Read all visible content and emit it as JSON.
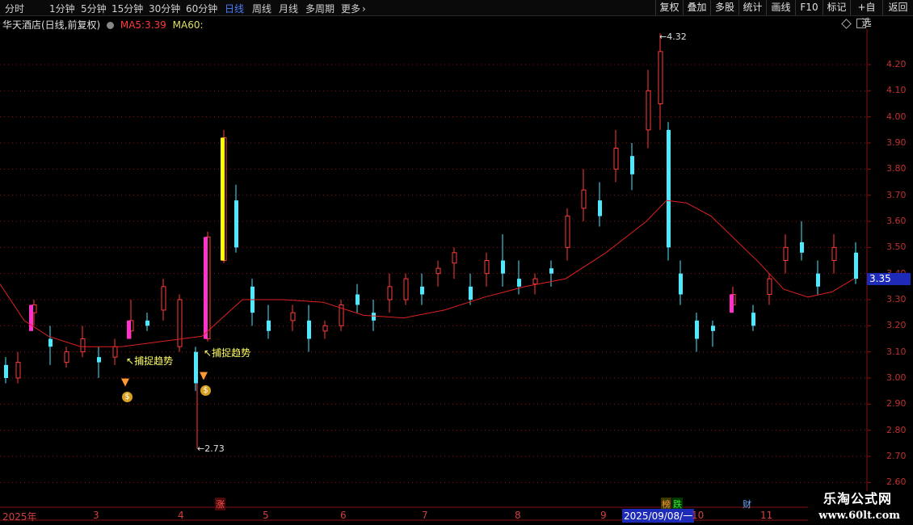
{
  "toolbar": {
    "timeframes": [
      "分时",
      "1分钟",
      "5分钟",
      "15分钟",
      "30分钟",
      "60分钟",
      "日线",
      "周线",
      "月线",
      "多周期",
      "更多"
    ],
    "active": "日线",
    "more_icon": "chevron-right-icon",
    "right_buttons": [
      "复权",
      "叠加",
      "多股",
      "统计",
      "画线",
      "F10",
      "标记",
      "+自选",
      "返回"
    ]
  },
  "legend": {
    "title": "华天酒店(日线,前复权)",
    "ma5_label": "MA5:",
    "ma5_value": "3.39",
    "ma60_label": "MA60:"
  },
  "annotations": {
    "high": "4.32",
    "low": "2.73",
    "signal1": "捕捉趋势",
    "signal2": "捕捉趋势",
    "arrow": "↖"
  },
  "markers": {
    "zhang": "涨",
    "bang": "榜",
    "die": "跌",
    "cai": "财"
  },
  "current_price": "3.35",
  "axis_ticks": [
    "4.20",
    "4.10",
    "4.00",
    "3.90",
    "3.80",
    "3.70",
    "3.60",
    "3.50",
    "3.40",
    "3.30",
    "3.20",
    "3.10",
    "3.00",
    "2.90",
    "2.80",
    "2.70",
    "2.60"
  ],
  "months": [
    "2025年",
    "3",
    "4",
    "5",
    "6",
    "7",
    "8",
    "9",
    "10",
    "11"
  ],
  "date_highlight": "2025/09/08/一",
  "watermark": {
    "line1": "乐淘公式网",
    "line2": "www.60lt.com"
  },
  "colors": {
    "up": "#ff3a3a",
    "down": "#4ee8ff",
    "ma60": "#e02020",
    "grid": "#8a1010",
    "signal_text": "#ffff66",
    "highlight_bar_yellow": "#ffff00",
    "highlight_bar_magenta": "#ff33cc"
  },
  "chart_data": {
    "type": "candlestick",
    "price_range": [
      2.6,
      4.32
    ],
    "high": 4.32,
    "low": 2.73,
    "last": 3.35,
    "ma5": 3.39,
    "ma60_approx": [
      [
        0,
        3.36
      ],
      [
        30,
        3.22
      ],
      [
        60,
        3.16
      ],
      [
        100,
        3.12
      ],
      [
        150,
        3.12
      ],
      [
        200,
        3.14
      ],
      [
        250,
        3.16
      ],
      [
        300,
        3.3
      ],
      [
        350,
        3.3
      ],
      [
        400,
        3.29
      ],
      [
        450,
        3.24
      ],
      [
        500,
        3.23
      ],
      [
        550,
        3.26
      ],
      [
        600,
        3.31
      ],
      [
        650,
        3.35
      ],
      [
        700,
        3.38
      ],
      [
        750,
        3.48
      ],
      [
        800,
        3.6
      ],
      [
        825,
        3.68
      ],
      [
        850,
        3.67
      ],
      [
        880,
        3.62
      ],
      [
        910,
        3.53
      ],
      [
        940,
        3.44
      ],
      [
        970,
        3.34
      ],
      [
        1000,
        3.31
      ],
      [
        1030,
        3.33
      ],
      [
        1057,
        3.38
      ]
    ],
    "candles_approx": [
      [
        5,
        3.05,
        3.0,
        3.08,
        2.98
      ],
      [
        20,
        3.0,
        3.06,
        3.1,
        2.98
      ],
      [
        40,
        3.25,
        3.28,
        3.3,
        3.2
      ],
      [
        60,
        3.15,
        3.12,
        3.2,
        3.05
      ],
      [
        80,
        3.06,
        3.1,
        3.12,
        3.04
      ],
      [
        100,
        3.1,
        3.15,
        3.2,
        3.08
      ],
      [
        120,
        3.08,
        3.06,
        3.12,
        3.0
      ],
      [
        140,
        3.08,
        3.12,
        3.15,
        3.05
      ],
      [
        160,
        3.18,
        3.22,
        3.3,
        3.15
      ],
      [
        180,
        3.22,
        3.2,
        3.25,
        3.18
      ],
      [
        200,
        3.26,
        3.35,
        3.38,
        3.22
      ],
      [
        220,
        3.12,
        3.3,
        3.32,
        3.1
      ],
      [
        240,
        3.1,
        2.98,
        3.12,
        2.95
      ],
      [
        255,
        3.15,
        3.54,
        3.56,
        3.14
      ],
      [
        275,
        3.45,
        3.92,
        3.95,
        3.44
      ],
      [
        290,
        3.68,
        3.5,
        3.74,
        3.48
      ],
      [
        310,
        3.35,
        3.25,
        3.38,
        3.2
      ],
      [
        330,
        3.22,
        3.18,
        3.28,
        3.15
      ],
      [
        360,
        3.22,
        3.25,
        3.28,
        3.18
      ],
      [
        380,
        3.22,
        3.15,
        3.28,
        3.1
      ],
      [
        400,
        3.18,
        3.2,
        3.22,
        3.15
      ],
      [
        420,
        3.2,
        3.28,
        3.3,
        3.18
      ],
      [
        440,
        3.32,
        3.28,
        3.36,
        3.25
      ],
      [
        460,
        3.25,
        3.22,
        3.3,
        3.18
      ],
      [
        480,
        3.3,
        3.35,
        3.4,
        3.25
      ],
      [
        500,
        3.3,
        3.38,
        3.4,
        3.28
      ],
      [
        520,
        3.35,
        3.32,
        3.4,
        3.28
      ],
      [
        540,
        3.4,
        3.42,
        3.45,
        3.35
      ],
      [
        560,
        3.44,
        3.48,
        3.5,
        3.38
      ],
      [
        580,
        3.35,
        3.3,
        3.4,
        3.28
      ],
      [
        600,
        3.4,
        3.45,
        3.48,
        3.35
      ],
      [
        620,
        3.45,
        3.4,
        3.55,
        3.35
      ],
      [
        640,
        3.38,
        3.35,
        3.45,
        3.32
      ],
      [
        660,
        3.36,
        3.38,
        3.4,
        3.32
      ],
      [
        680,
        3.42,
        3.4,
        3.45,
        3.35
      ],
      [
        700,
        3.5,
        3.62,
        3.65,
        3.45
      ],
      [
        720,
        3.65,
        3.72,
        3.8,
        3.6
      ],
      [
        740,
        3.68,
        3.62,
        3.75,
        3.58
      ],
      [
        760,
        3.8,
        3.88,
        3.95,
        3.75
      ],
      [
        780,
        3.85,
        3.78,
        3.9,
        3.72
      ],
      [
        800,
        3.95,
        4.1,
        4.18,
        3.88
      ],
      [
        815,
        4.05,
        4.25,
        4.32,
        3.95
      ],
      [
        825,
        3.95,
        3.5,
        3.98,
        3.45
      ],
      [
        840,
        3.4,
        3.32,
        3.45,
        3.28
      ],
      [
        860,
        3.22,
        3.15,
        3.25,
        3.1
      ],
      [
        880,
        3.2,
        3.18,
        3.22,
        3.12
      ],
      [
        905,
        3.28,
        3.32,
        3.35,
        3.25
      ],
      [
        930,
        3.25,
        3.2,
        3.28,
        3.18
      ],
      [
        950,
        3.32,
        3.38,
        3.4,
        3.28
      ],
      [
        970,
        3.45,
        3.5,
        3.55,
        3.4
      ],
      [
        990,
        3.52,
        3.48,
        3.6,
        3.45
      ],
      [
        1010,
        3.4,
        3.35,
        3.45,
        3.32
      ],
      [
        1030,
        3.45,
        3.5,
        3.55,
        3.4
      ],
      [
        1057,
        3.48,
        3.38,
        3.52,
        3.36
      ]
    ]
  }
}
